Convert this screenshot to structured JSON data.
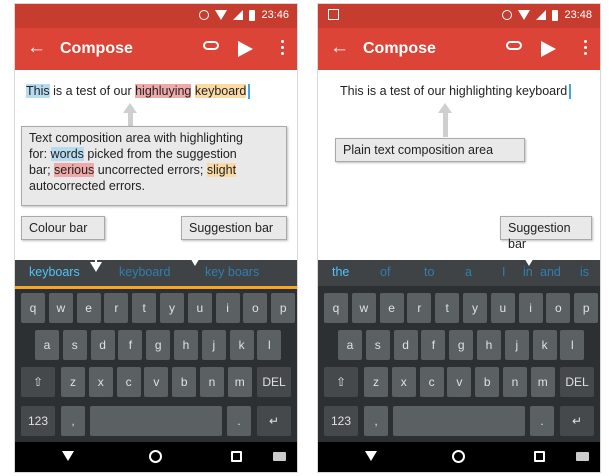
{
  "left": {
    "status": {
      "time": "23:46"
    },
    "appbar": {
      "title": "Compose"
    },
    "compose": {
      "parts": [
        "This",
        " is a test of our ",
        "highluying",
        " ",
        "keyboard"
      ]
    },
    "callout_main": {
      "line1": "Text composition area with highlighting",
      "line2_a": "for: ",
      "line2_b": "words",
      "line2_c": " picked from the suggestion",
      "line3_a": "bar; ",
      "line3_b": "serious",
      "line3_c": " uncorrected errors; ",
      "line3_d": "slight",
      "line4": "autocorrected errors."
    },
    "callout_colour_bar": "Colour bar",
    "callout_suggestion_bar": "Suggestion bar",
    "suggestions": [
      "keyboars",
      "keyboard",
      "key boars"
    ]
  },
  "right": {
    "status": {
      "time": "23:48"
    },
    "appbar": {
      "title": "Compose"
    },
    "compose": {
      "text": "This is a test of our highlighting keyboard"
    },
    "callout_plain": "Plain text composition area",
    "callout_suggestion_bar": "Suggestion bar",
    "suggestions": [
      "the",
      "of",
      "to",
      "a",
      "I",
      "in",
      "and",
      "is"
    ]
  },
  "keyboard": {
    "row1": [
      "q",
      "w",
      "e",
      "r",
      "t",
      "y",
      "u",
      "i",
      "o",
      "p"
    ],
    "row2": [
      "a",
      "s",
      "d",
      "f",
      "g",
      "h",
      "j",
      "k",
      "l"
    ],
    "row3": [
      "z",
      "x",
      "c",
      "v",
      "b",
      "n",
      "m"
    ],
    "shift_label": "⇧",
    "del_label": "DEL",
    "num_label": "123",
    "comma_label": ",",
    "period_label": ".",
    "enter_label": "↵"
  },
  "colors": {
    "status_bar": "#c63d2f",
    "app_bar": "#db4437",
    "suggestion_highlight": "#4fc3f7",
    "colour_bar": "#f5a623",
    "highlight_blue": "#b7dcf1",
    "highlight_red": "#f0a9a9",
    "highlight_yellow": "#fbd9a3"
  }
}
